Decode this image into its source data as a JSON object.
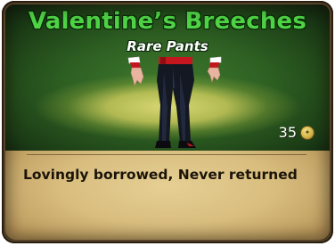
{
  "item": {
    "name": "Valentine’s Breeches",
    "rarity_type": "Rare Pants",
    "price": "35",
    "description": "Lovingly borrowed, Never returned"
  },
  "icons": {
    "currency": "coin-icon"
  },
  "colors": {
    "title": "#4fd446",
    "art_background": "#2d5f22",
    "description_panel": "#d8bd7e",
    "pants": "#141822",
    "waistband": "#c4161c"
  }
}
